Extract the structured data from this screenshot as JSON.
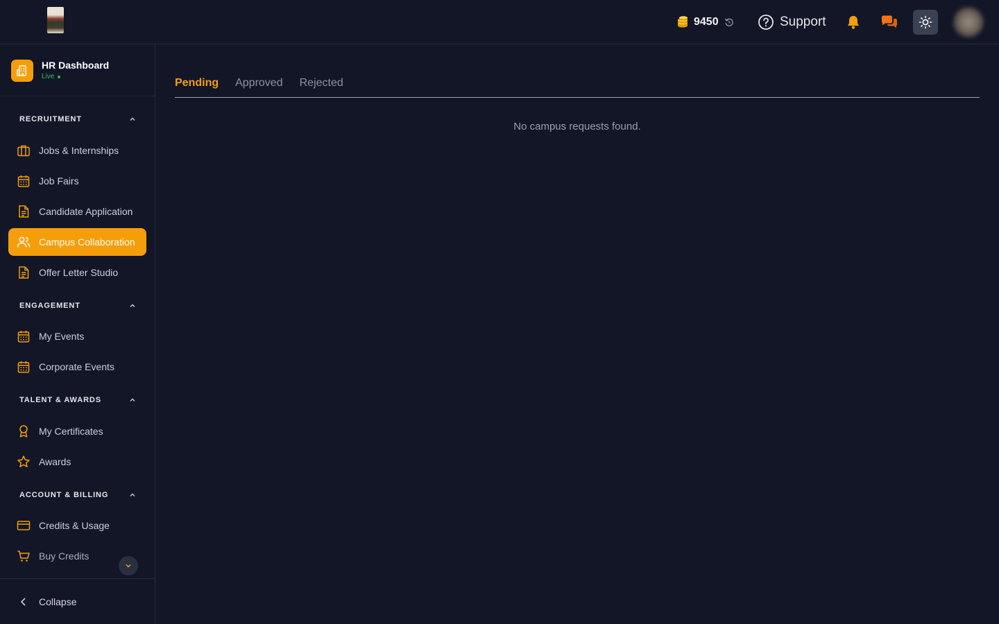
{
  "header": {
    "credits_amount": "9450",
    "support_label": "Support",
    "icons": [
      "coins-icon",
      "refresh-icon",
      "help-circle-icon",
      "bell-icon",
      "chat-icon",
      "sun-icon"
    ]
  },
  "sidebar": {
    "brand_name": "HR Dashboard",
    "brand_status": "Live",
    "sections": [
      {
        "title": "RECRUITMENT",
        "items": [
          {
            "label": "Jobs & Internships",
            "icon": "briefcase-icon"
          },
          {
            "label": "Job Fairs",
            "icon": "calendar-icon"
          },
          {
            "label": "Candidate Application",
            "icon": "document-icon"
          },
          {
            "label": "Campus Collaboration",
            "icon": "users-icon",
            "active": true
          },
          {
            "label": "Offer Letter Studio",
            "icon": "document-icon"
          }
        ]
      },
      {
        "title": "ENGAGEMENT",
        "items": [
          {
            "label": "My Events",
            "icon": "calendar-icon"
          },
          {
            "label": "Corporate Events",
            "icon": "calendar-icon"
          }
        ]
      },
      {
        "title": "TALENT & AWARDS",
        "items": [
          {
            "label": "My Certificates",
            "icon": "award-icon"
          },
          {
            "label": "Awards",
            "icon": "star-icon"
          }
        ]
      },
      {
        "title": "ACCOUNT & BILLING",
        "items": [
          {
            "label": "Credits & Usage",
            "icon": "credit-card-icon"
          },
          {
            "label": "Buy Credits",
            "icon": "cart-icon"
          }
        ]
      }
    ],
    "collapse_label": "Collapse"
  },
  "main": {
    "tabs": [
      "Pending",
      "Approved",
      "Rejected"
    ],
    "active_tab": "Pending",
    "empty_message": "No campus requests found."
  },
  "colors": {
    "background": "#121626",
    "accent": "#f59e0b",
    "live": "#22c55e"
  }
}
